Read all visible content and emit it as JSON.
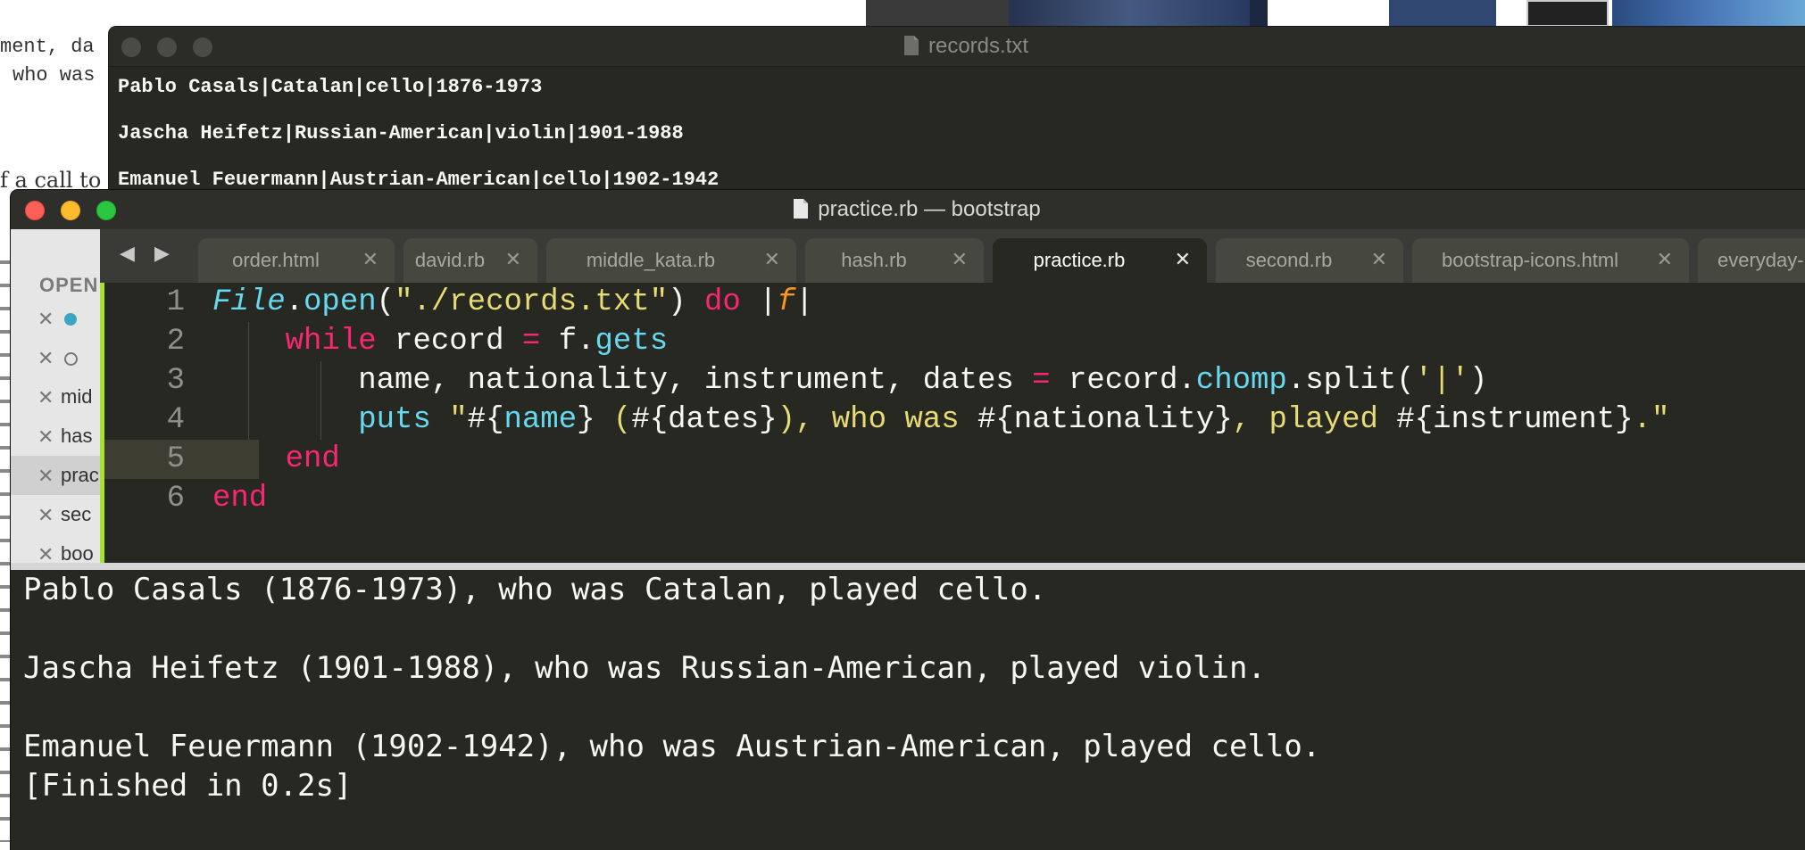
{
  "background": {
    "doc_fragments": [
      "ment, da",
      "who was",
      "f a call to"
    ]
  },
  "records_window": {
    "title": "records.txt",
    "lines": [
      "Pablo Casals|Catalan|cello|1876-1973",
      "",
      "Jascha Heifetz|Russian-American|violin|1901-1988",
      "",
      "Emanuel Feuermann|Austrian-American|cello|1902-1942"
    ]
  },
  "practice_window": {
    "title": "practice.rb — bootstrap",
    "sidebar": {
      "header": "OPEN",
      "items": [
        {
          "label": "",
          "state": "modified"
        },
        {
          "label": "",
          "state": "open"
        },
        {
          "label": "mid",
          "state": "normal"
        },
        {
          "label": "has",
          "state": "normal"
        },
        {
          "label": "prac",
          "state": "selected"
        },
        {
          "label": "sec",
          "state": "normal"
        },
        {
          "label": "boo",
          "state": "normal"
        }
      ]
    },
    "nav_arrows": "◀ ▶",
    "tabs": [
      {
        "label": "order.html",
        "active": false
      },
      {
        "label": "david.rb",
        "active": false
      },
      {
        "label": "middle_kata.rb",
        "active": false
      },
      {
        "label": "hash.rb",
        "active": false
      },
      {
        "label": "practice.rb",
        "active": true
      },
      {
        "label": "second.rb",
        "active": false
      },
      {
        "label": "bootstrap-icons.html",
        "active": false
      },
      {
        "label": "everyday-",
        "active": false
      }
    ],
    "tab_close_glyph": "✕",
    "editor": {
      "line_numbers": [
        "1",
        "2",
        "3",
        "4",
        "5",
        "6"
      ],
      "current_line": 6,
      "code_text": [
        "File.open(\"./records.txt\") do |f|",
        "    while record = f.gets",
        "        name, nationality, instrument, dates = record.chomp.split('|')",
        "        puts \"#{name} (#{dates}), who was #{nationality}, played #{instrument}.\"",
        "    end",
        "end"
      ]
    },
    "output": [
      "Pablo Casals (1876-1973), who was Catalan, played cello.",
      "",
      "Jascha Heifetz (1901-1988), who was Russian-American, played violin.",
      "",
      "Emanuel Feuermann (1902-1942), who was Austrian-American, played cello.",
      "[Finished in 0.2s]"
    ]
  },
  "colors": {
    "editor_bg": "#272822",
    "keyword": "#f92672",
    "function": "#66d9ef",
    "string": "#e6db74",
    "parameter": "#fd971f",
    "gutter_marker": "#a6e22e"
  }
}
